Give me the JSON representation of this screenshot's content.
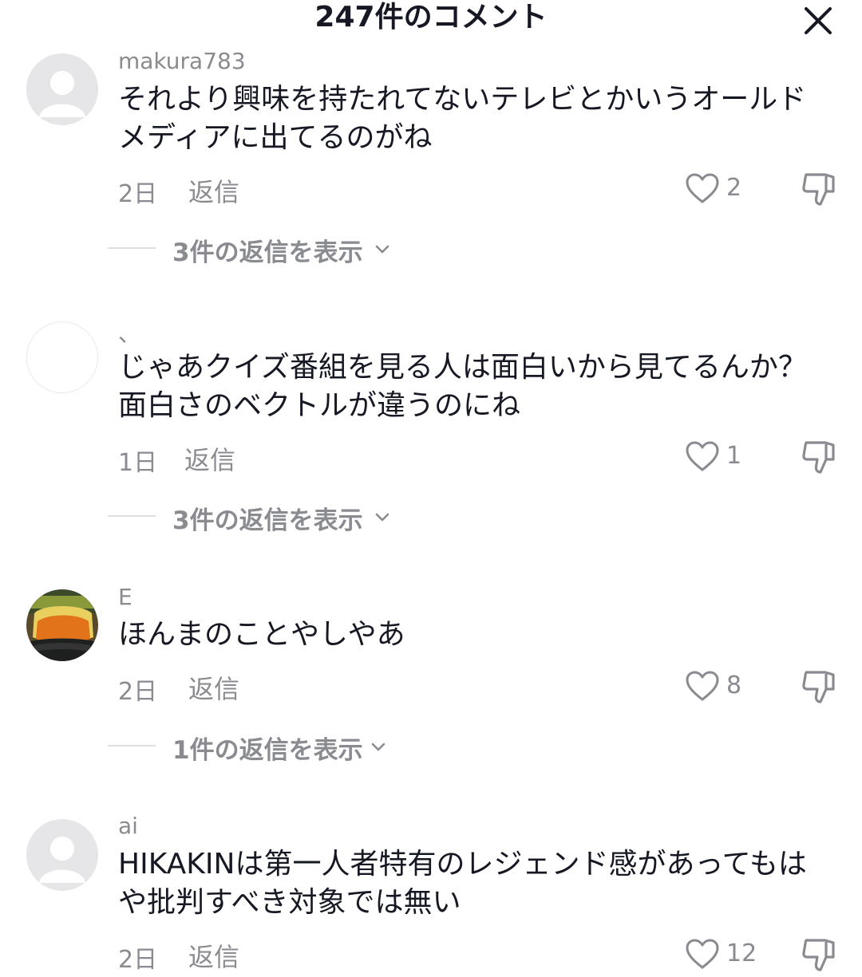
{
  "header": {
    "title": "247件のコメント",
    "close_icon": "close-icon"
  },
  "comments": [
    {
      "username": "makura783",
      "text": "それより興味を持たれてないテレビとかいうオールド\nメディアに出てるのがね",
      "time": "2日",
      "reply_label": "返信",
      "likes": "2",
      "view_replies": "3件の返信を表示",
      "avatar": "default-avatar"
    },
    {
      "username": "、",
      "text": "じゃあクイズ番組を見る人は面白いから見てるんか？\n面白さのベクトルが違うのにね",
      "time": "1日",
      "reply_label": "返信",
      "likes": "1",
      "view_replies": "3件の返信を表示",
      "avatar": "blank-avatar"
    },
    {
      "username": "E",
      "text": "ほんまのことやしやあ",
      "time": "2日",
      "reply_label": "返信",
      "likes": "8",
      "view_replies": "1件の返信を表示",
      "avatar": "photo-avatar"
    },
    {
      "username": "ai",
      "text": "HIKAKINは第一人者特有のレジェンド感があってもは\nや批判すべき対象では無い",
      "time": "2日",
      "reply_label": "返信",
      "likes": "12",
      "avatar": "default-avatar"
    }
  ],
  "colors": {
    "text": "#161823",
    "muted": "#8a8b91",
    "avatar_bg": "#e6e6e9"
  }
}
